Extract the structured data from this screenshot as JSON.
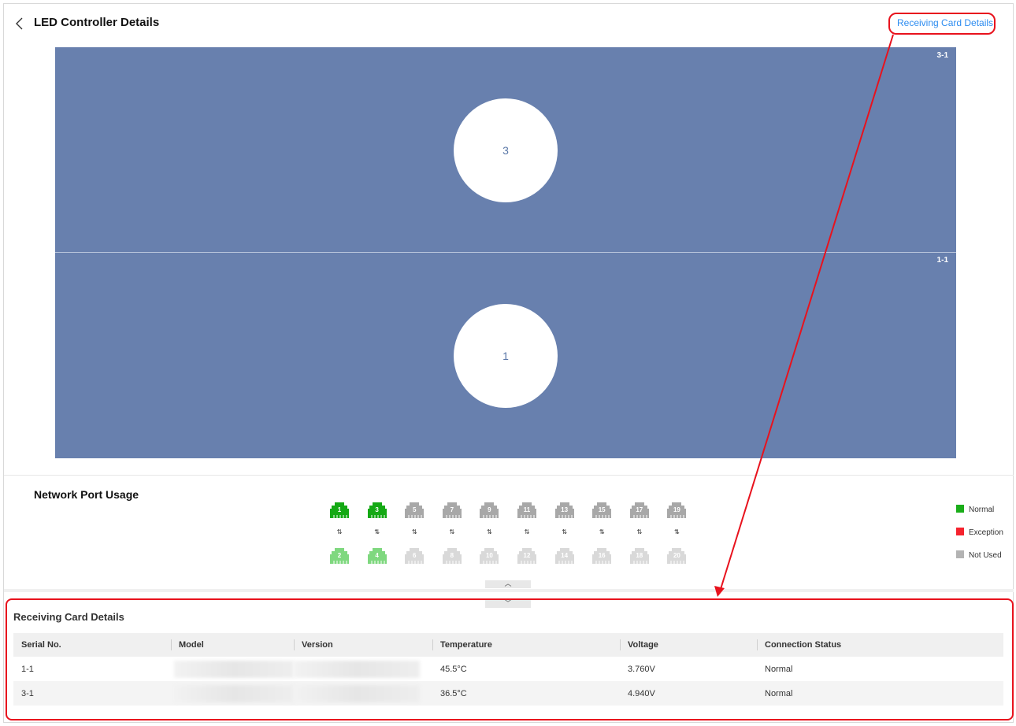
{
  "header": {
    "title": "LED Controller Details",
    "receiving_card_link": "Receiving Card Details"
  },
  "screen": {
    "panels": [
      {
        "id_label": "3-1",
        "number": "3"
      },
      {
        "id_label": "1-1",
        "number": "1"
      }
    ]
  },
  "network": {
    "title": "Network Port Usage",
    "top_ports": [
      "1",
      "3",
      "5",
      "7",
      "9",
      "11",
      "13",
      "15",
      "17",
      "19"
    ],
    "bottom_ports": [
      "2",
      "4",
      "6",
      "8",
      "10",
      "12",
      "14",
      "16",
      "18",
      "20"
    ],
    "top_status": [
      "normal",
      "normal",
      "not-used",
      "not-used",
      "not-used",
      "not-used",
      "not-used",
      "not-used",
      "not-used",
      "not-used"
    ],
    "bottom_status": [
      "normal",
      "normal",
      "not-used",
      "not-used",
      "not-used",
      "not-used",
      "not-used",
      "not-used",
      "not-used",
      "not-used"
    ],
    "link_glyph": "⇅",
    "legend": [
      {
        "label": "Normal",
        "color": "#1aad19"
      },
      {
        "label": "Exception",
        "color": "#f5222d"
      },
      {
        "label": "Not Used",
        "color": "#b3b3b3"
      }
    ],
    "collapse_glyph": "︿",
    "expand_glyph": "﹀"
  },
  "receiving_cards": {
    "title": "Receiving Card Details",
    "columns": [
      "Serial No.",
      "Model",
      "Version",
      "Temperature",
      "Voltage",
      "Connection Status"
    ],
    "rows": [
      {
        "serial": "1-1",
        "temperature": "45.5°C",
        "voltage": "3.760V",
        "status": "Normal"
      },
      {
        "serial": "3-1",
        "temperature": "36.5°C",
        "voltage": "4.940V",
        "status": "Normal"
      }
    ]
  }
}
